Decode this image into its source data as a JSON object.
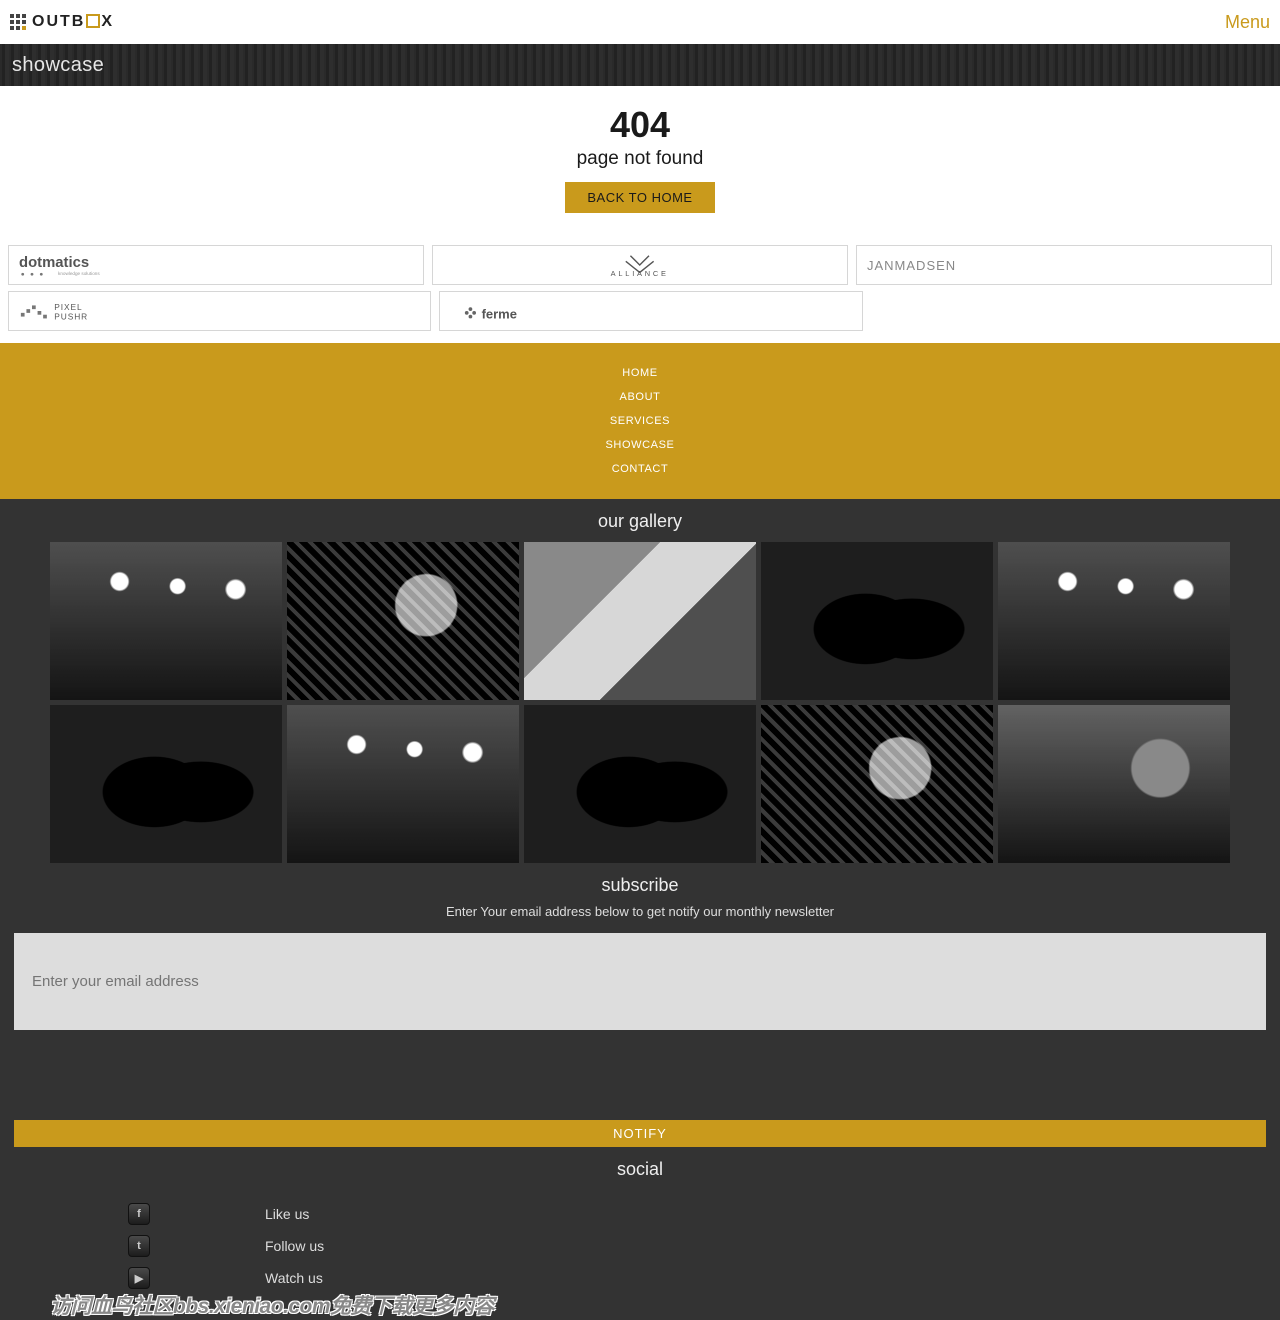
{
  "header": {
    "brand_word1": "OUTB",
    "brand_word2": "X",
    "menu_label": "Menu"
  },
  "banner": {
    "title": "showcase"
  },
  "error": {
    "code": "404",
    "message": "page not found",
    "button": "BACK TO HOME"
  },
  "clients": {
    "row1": [
      {
        "name": "dotmatics",
        "tagline": "knowledge solutions"
      },
      {
        "name": "ALLIANCE",
        "tagline": ""
      },
      {
        "name": "JANMADSEN",
        "tagline": ""
      }
    ],
    "row2": [
      {
        "name": "PIXEL PUSHR",
        "tagline": ""
      },
      {
        "name": "ferme",
        "tagline": ""
      }
    ]
  },
  "footer_nav": [
    "HOME",
    "ABOUT",
    "SERVICES",
    "SHOWCASE",
    "CONTACT"
  ],
  "gallery": {
    "title": "our gallery"
  },
  "subscribe": {
    "title": "subscribe",
    "desc": "Enter Your email address below to get notify our monthly newsletter",
    "placeholder": "Enter your email address",
    "button": "NOTIFY"
  },
  "social": {
    "title": "social",
    "items": [
      {
        "icon": "f",
        "label": "Like us"
      },
      {
        "icon": "t",
        "label": "Follow us"
      },
      {
        "icon": "▶",
        "label": "Watch us"
      }
    ]
  },
  "watermark": "访问血鸟社区bbs.xieniao.com免费下载更多内容"
}
